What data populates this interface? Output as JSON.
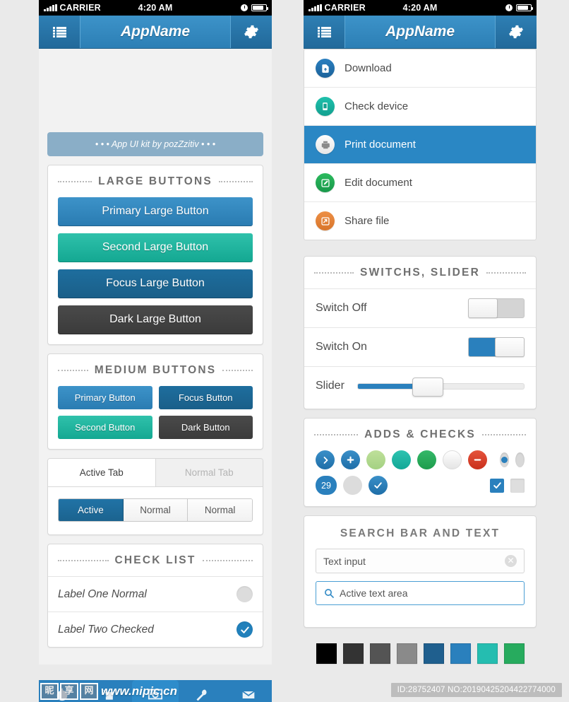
{
  "status_bar": {
    "carrier": "CARRIER",
    "time": "4:20 AM"
  },
  "nav": {
    "title": "AppName",
    "menu_icon": "list-icon",
    "settings_icon": "gear-icon"
  },
  "left": {
    "banner": "• • • App UI kit by pozZzitiv • • •",
    "large_buttons": {
      "title": "LARGE BUTTONS",
      "items": [
        {
          "label": "Primary Large Button",
          "style": "primary"
        },
        {
          "label": "Second Large Button",
          "style": "second"
        },
        {
          "label": "Focus Large Button",
          "style": "focus"
        },
        {
          "label": "Dark Large Button",
          "style": "dark"
        }
      ]
    },
    "medium_buttons": {
      "title": "MEDIUM BUTTONS",
      "items": [
        {
          "label": "Primary Button",
          "style": "primary"
        },
        {
          "label": "Focus Button",
          "style": "focus"
        },
        {
          "label": "Second Button",
          "style": "second"
        },
        {
          "label": "Dark Button",
          "style": "dark"
        }
      ]
    },
    "tabs": {
      "top": [
        {
          "label": "Active Tab",
          "active": true
        },
        {
          "label": "Normal Tab",
          "active": false
        }
      ],
      "segmented": [
        {
          "label": "Active",
          "active": true
        },
        {
          "label": "Normal",
          "active": false
        },
        {
          "label": "Normal",
          "active": false
        }
      ]
    },
    "check_list": {
      "title": "CHECK LIST",
      "rows": [
        {
          "label": "Label One Normal",
          "checked": false
        },
        {
          "label": "Label Two Checked",
          "checked": true
        }
      ]
    }
  },
  "right": {
    "menu": [
      {
        "label": "Download",
        "icon": "download-icon",
        "color": "#1f6fb0",
        "selected": false
      },
      {
        "label": "Check device",
        "icon": "device-icon",
        "color": "#16a99a",
        "selected": false
      },
      {
        "label": "Print document",
        "icon": "printer-icon",
        "color": "#f0f0f0",
        "selected": true
      },
      {
        "label": "Edit document",
        "icon": "edit-icon",
        "color": "#22a84f",
        "selected": false
      },
      {
        "label": "Share file",
        "icon": "share-icon",
        "color": "#e0802f",
        "selected": false
      }
    ],
    "switches": {
      "title": "SWITCHS, SLIDER",
      "rows": [
        {
          "label": "Switch Off",
          "type": "switch",
          "on": false
        },
        {
          "label": "Switch On",
          "type": "switch",
          "on": true
        },
        {
          "label": "Slider",
          "type": "slider",
          "value": 36
        }
      ]
    },
    "adds": {
      "title": "ADDS & CHECKS",
      "row1": [
        {
          "name": "chevron-right-badge",
          "color": "#2a80bd",
          "glyph": "chevron"
        },
        {
          "name": "plus-badge",
          "color": "#2a80bd",
          "glyph": "plus"
        },
        {
          "name": "light-green-dot",
          "color": "#a8d islands",
          "glyph": ""
        },
        {
          "name": "teal-dot",
          "color": "#18b3a0",
          "glyph": ""
        },
        {
          "name": "green-dot",
          "color": "#26a85a",
          "glyph": ""
        },
        {
          "name": "white-dot",
          "color": "#f4f4f4",
          "glyph": ""
        },
        {
          "name": "minus-badge",
          "color": "#d93f2b",
          "glyph": "minus"
        }
      ],
      "radio_on": true,
      "radio_off": false,
      "badge_count": "29",
      "gray_dot": "",
      "check_dot": true,
      "checkbox_checked": true,
      "checkbox_empty": false
    },
    "search": {
      "title": "SEARCH BAR AND TEXT",
      "input_value": "Text input",
      "input_placeholder": "Text input",
      "clear_icon": "clear-icon",
      "active_value": "Active text area",
      "active_placeholder": "Active text area",
      "search_icon": "search-icon"
    },
    "swatches": [
      "#000000",
      "#333333",
      "#545454",
      "#8a8a8a",
      "#1f5f8e",
      "#2a80bd",
      "#25bdb0",
      "#27ab5e"
    ]
  },
  "watermark": {
    "site": "www.nipic.cn",
    "cn_chars": [
      "昵",
      "享",
      "网"
    ],
    "id_text": "ID:28752407 NO:20190425204422774000"
  }
}
